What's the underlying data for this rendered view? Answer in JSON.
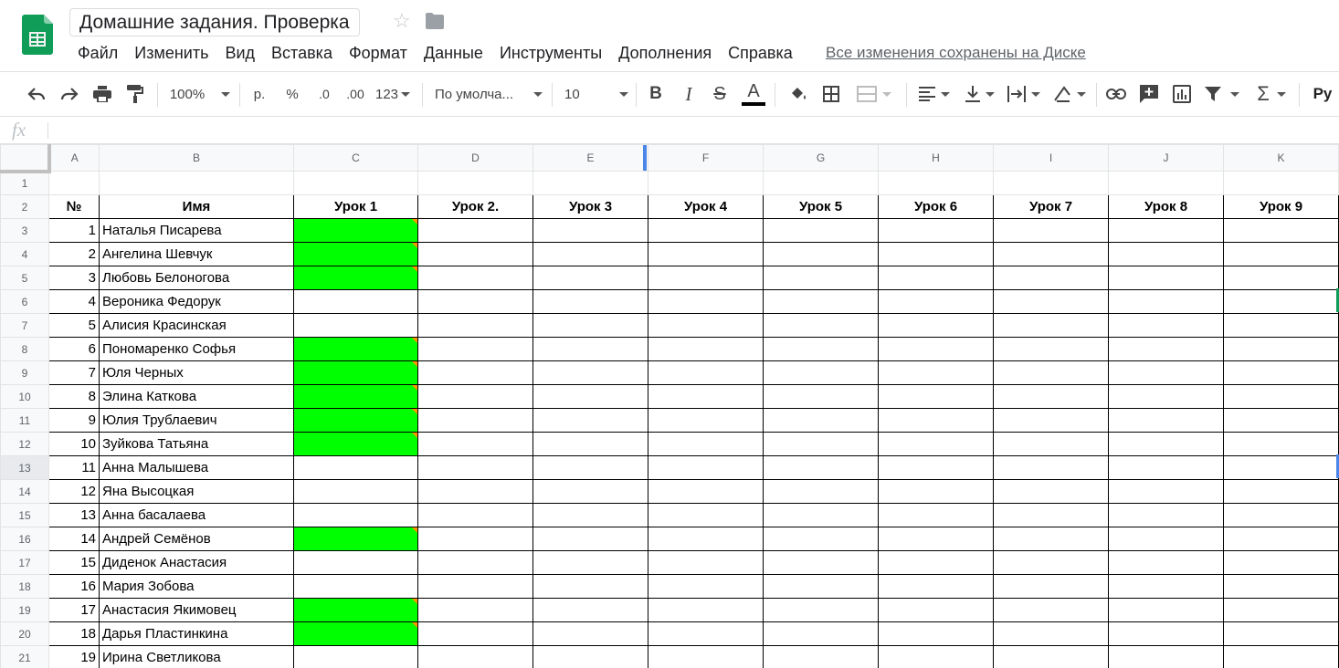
{
  "app": {
    "doc_title": "Домашние задания. Проверка",
    "save_status": "Все изменения сохранены на Диске"
  },
  "menu": [
    "Файл",
    "Изменить",
    "Вид",
    "Вставка",
    "Формат",
    "Данные",
    "Инструменты",
    "Дополнения",
    "Справка"
  ],
  "toolbar": {
    "zoom": "100%",
    "currency": "р.",
    "percent": "%",
    "dec_decrease": ".0",
    "dec_increase": ".00",
    "number_format": "123",
    "font": "По умолча...",
    "font_size": "10",
    "bold": "B",
    "italic": "I",
    "strike": "S",
    "text_color": "A",
    "input_tools": "Ру"
  },
  "formula_bar": {
    "fx": "fx",
    "value": ""
  },
  "colors": {
    "green_fill": "#00ff00",
    "comment_marker": "#ff9800",
    "selection_blue": "#4a86e8",
    "sheets_green": "#0f9d58"
  },
  "sheet": {
    "columns": [
      "A",
      "B",
      "C",
      "D",
      "E",
      "F",
      "G",
      "H",
      "I",
      "J",
      "K"
    ],
    "header_row": [
      "№",
      "Имя",
      "Урок 1",
      "Урок 2.",
      "Урок 3",
      "Урок 4",
      "Урок 5",
      "Урок 6",
      "Урок 7",
      "Урок 8",
      "Урок 9"
    ],
    "students": [
      {
        "row": "3",
        "num": "1",
        "name": "Наталья Писарева",
        "lesson1_done": true
      },
      {
        "row": "4",
        "num": "2",
        "name": "Ангелина Шевчук",
        "lesson1_done": true
      },
      {
        "row": "5",
        "num": "3",
        "name": "Любовь Белоногова",
        "lesson1_done": true
      },
      {
        "row": "6",
        "num": "4",
        "name": "Вероника Федорук",
        "lesson1_done": false
      },
      {
        "row": "7",
        "num": "5",
        "name": "Алисия Красинская",
        "lesson1_done": false
      },
      {
        "row": "8",
        "num": "6",
        "name": "Пономаренко Софья",
        "lesson1_done": true
      },
      {
        "row": "9",
        "num": "7",
        "name": "Юля Черных",
        "lesson1_done": true
      },
      {
        "row": "10",
        "num": "8",
        "name": "Элина Каткова",
        "lesson1_done": true
      },
      {
        "row": "11",
        "num": "9",
        "name": "Юлия Трублаевич",
        "lesson1_done": true
      },
      {
        "row": "12",
        "num": "10",
        "name": "Зуйкова Татьяна",
        "lesson1_done": true
      },
      {
        "row": "13",
        "num": "11",
        "name": "Анна Малышева",
        "lesson1_done": false
      },
      {
        "row": "14",
        "num": "12",
        "name": "Яна Высоцкая",
        "lesson1_done": false
      },
      {
        "row": "15",
        "num": "13",
        "name": "Анна басалаева",
        "lesson1_done": false
      },
      {
        "row": "16",
        "num": "14",
        "name": "Андрей Семёнов",
        "lesson1_done": true
      },
      {
        "row": "17",
        "num": "15",
        "name": "Диденок Анастасия",
        "lesson1_done": false
      },
      {
        "row": "18",
        "num": "16",
        "name": "Мария Зобова",
        "lesson1_done": false
      },
      {
        "row": "19",
        "num": "17",
        "name": "Анастасия Якимовец",
        "lesson1_done": true
      },
      {
        "row": "20",
        "num": "18",
        "name": "Дарья Пластинкина",
        "lesson1_done": true
      },
      {
        "row": "21",
        "num": "19",
        "name": "Ирина Светликова",
        "lesson1_done": false
      }
    ]
  }
}
